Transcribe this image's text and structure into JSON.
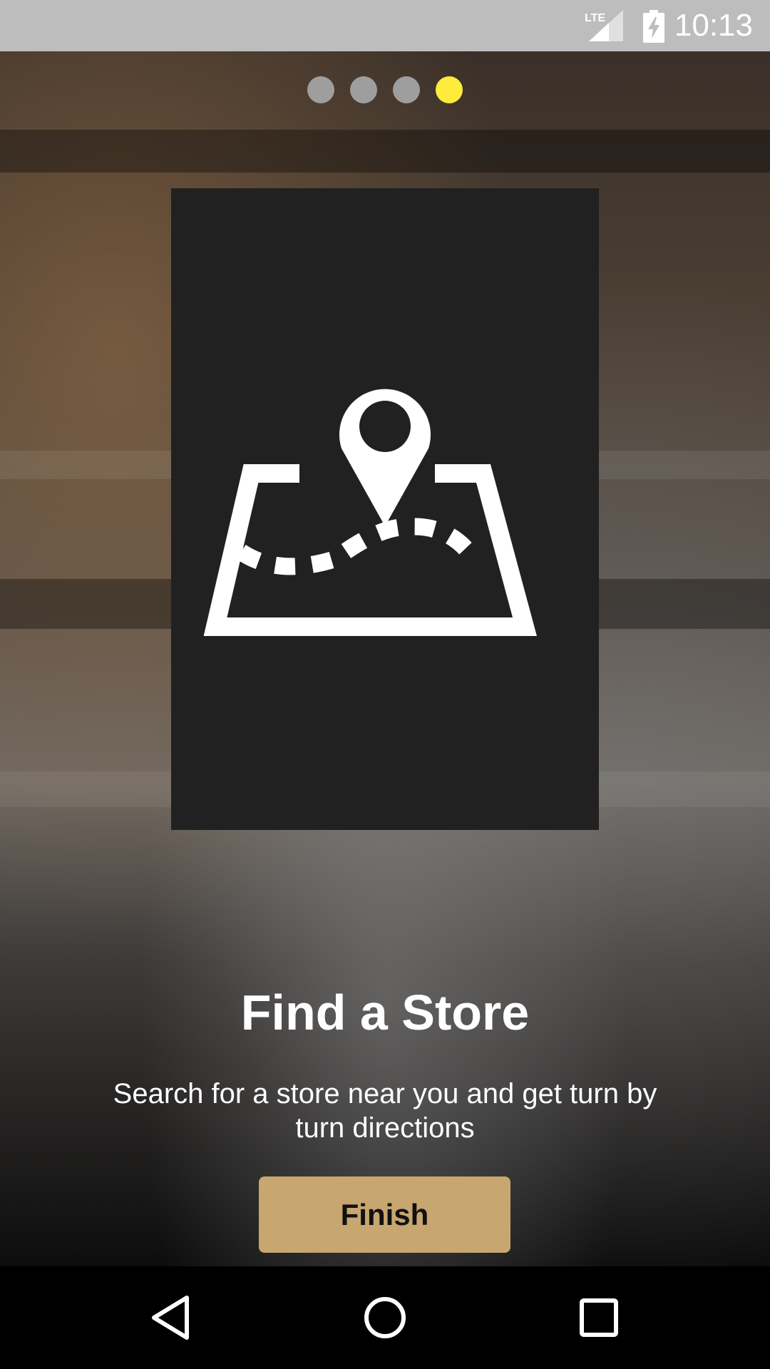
{
  "status_bar": {
    "time": "10:13",
    "network_label": "LTE",
    "icons": [
      "lte-signal-icon",
      "battery-charging-icon"
    ]
  },
  "onboarding": {
    "page_indicator": {
      "total": 4,
      "active_index": 3,
      "active_color": "#ffeb3b",
      "inactive_color": "#9e9e9e"
    },
    "illustration_icon": "map-location-pin-icon",
    "title": "Find a Store",
    "description": "Search for a store near you and get turn by turn directions",
    "finish_label": "Finish",
    "accent_color": "#c8a670"
  },
  "nav_bar": {
    "buttons": [
      "back-icon",
      "home-icon",
      "recents-icon"
    ]
  }
}
